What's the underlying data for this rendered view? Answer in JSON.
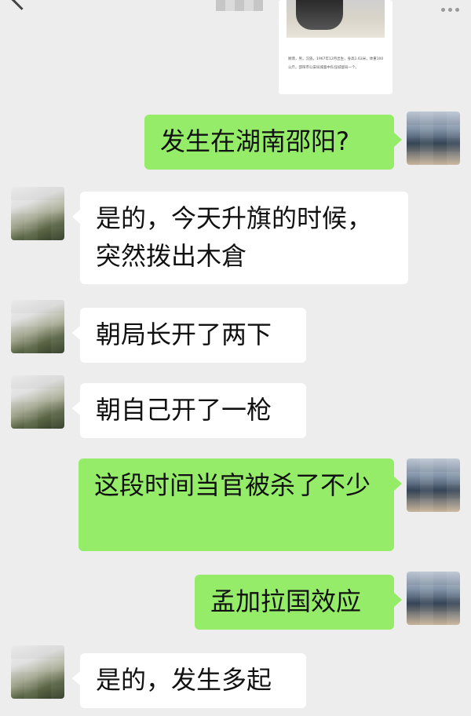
{
  "image_card": {
    "caption": "顾翡，男，汉族，1967年12月出生，身高1.63米，体重100公斤。邵阳市公安局城督中队任城督局一个。"
  },
  "messages": [
    {
      "side": "right",
      "text": "发生在湖南邵阳?"
    },
    {
      "side": "left",
      "text": "是的，今天升旗的时候，突然拨出木倉"
    },
    {
      "side": "left",
      "text": "朝局长开了两下"
    },
    {
      "side": "left",
      "text": "朝自己开了一枪"
    },
    {
      "side": "right",
      "text": "这段时间当官被杀了不少"
    },
    {
      "side": "right",
      "text": "孟加拉国效应"
    },
    {
      "side": "left",
      "text": "是的，发生多起"
    }
  ],
  "colors": {
    "background": "#ededed",
    "sent_bubble": "#95ec69",
    "received_bubble": "#ffffff"
  },
  "icons": {
    "back": "chevron-left-icon",
    "menu": "more-icon"
  }
}
